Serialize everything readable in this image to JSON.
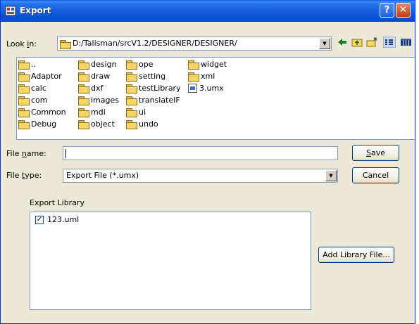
{
  "window": {
    "title": "Export",
    "help_icon": "help-icon",
    "close_icon": "close-icon"
  },
  "look_in": {
    "label_pre": "Look ",
    "label_accel": "i",
    "label_post": "n:",
    "value": "D:/Talisman/srcV1.2/DESIGNER/DESIGNER/"
  },
  "toolbar": {
    "icons": [
      "back-arrow-icon",
      "up-folder-icon",
      "new-folder-icon",
      "list-view-icon",
      "details-view-icon"
    ]
  },
  "files": [
    {
      "name": "..",
      "kind": "folder"
    },
    {
      "name": "Adaptor",
      "kind": "folder"
    },
    {
      "name": "calc",
      "kind": "folder"
    },
    {
      "name": "com",
      "kind": "folder"
    },
    {
      "name": "Common",
      "kind": "folder"
    },
    {
      "name": "Debug",
      "kind": "folder"
    },
    {
      "name": "design",
      "kind": "folder"
    },
    {
      "name": "draw",
      "kind": "folder"
    },
    {
      "name": "dxf",
      "kind": "folder"
    },
    {
      "name": "images",
      "kind": "folder"
    },
    {
      "name": "mdi",
      "kind": "folder"
    },
    {
      "name": "object",
      "kind": "folder"
    },
    {
      "name": "ope",
      "kind": "folder"
    },
    {
      "name": "setting",
      "kind": "folder"
    },
    {
      "name": "testLibrary",
      "kind": "folder"
    },
    {
      "name": "translateIF",
      "kind": "folder"
    },
    {
      "name": "ui",
      "kind": "folder"
    },
    {
      "name": "undo",
      "kind": "folder"
    },
    {
      "name": "widget",
      "kind": "folder"
    },
    {
      "name": "xml",
      "kind": "folder"
    },
    {
      "name": "3.umx",
      "kind": "file"
    }
  ],
  "file_name": {
    "label_pre": "File ",
    "label_accel": "n",
    "label_post": "ame:",
    "value": ""
  },
  "file_type": {
    "label_pre": "File ",
    "label_accel": "t",
    "label_post": "ype:",
    "value": "Export File (*.umx)"
  },
  "buttons": {
    "save_accel": "S",
    "save_rest": "ave",
    "cancel": "Cancel",
    "add_library": "Add Library File..."
  },
  "export_library": {
    "heading": "Export Library",
    "items": [
      {
        "label": "123.uml",
        "checked": true
      }
    ]
  }
}
